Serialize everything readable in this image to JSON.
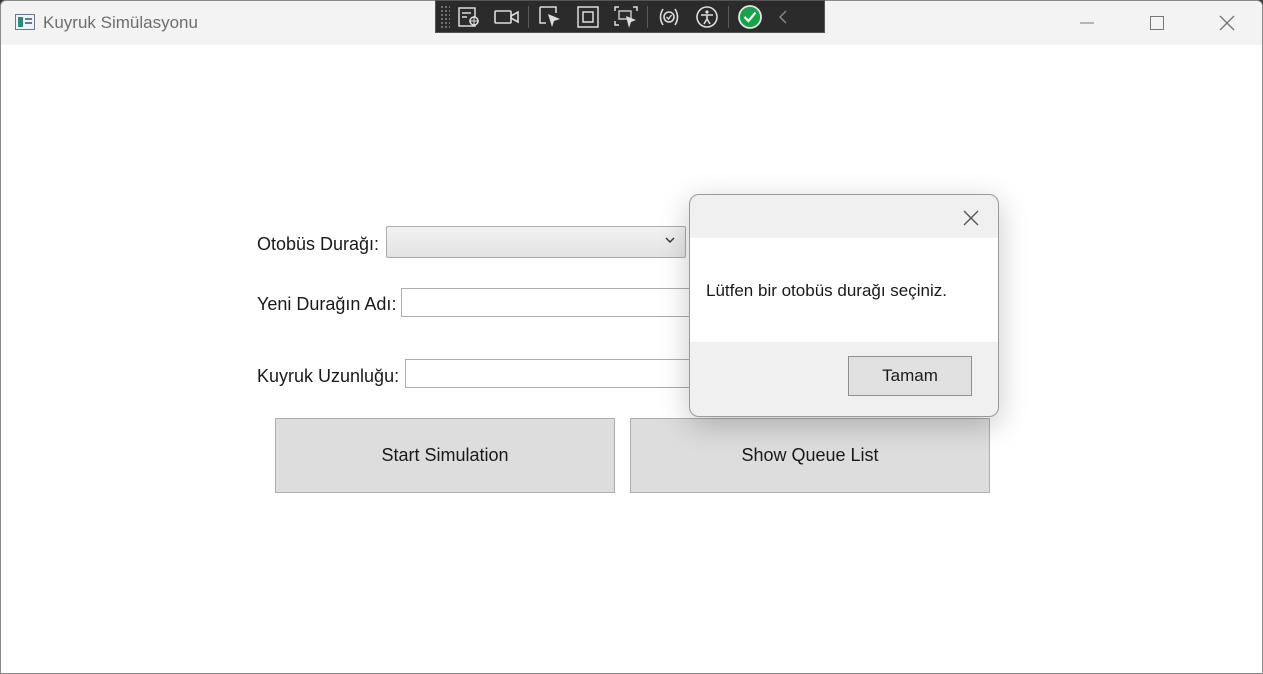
{
  "window": {
    "title": "Kuyruk Simülasyonu"
  },
  "devtools_toolbar": {
    "items": [
      "live-visual-tree-icon",
      "video-camera-icon",
      "select-element-icon",
      "display-layout-adorners-icon",
      "track-focus-icon",
      "binding-failures-icon",
      "accessibility-icon",
      "hot-reload-ok-icon",
      "collapse-chevron-icon"
    ]
  },
  "form": {
    "bus_stop_label": "Otobüs Durağı:",
    "new_stop_label": "Yeni Durağın Adı:",
    "queue_length_label": "Kuyruk Uzunluğu:",
    "bus_stop_value": "",
    "new_stop_value": "",
    "queue_length_value": "",
    "start_button": "Start Simulation",
    "show_queue_button": "Show Queue List"
  },
  "dialog": {
    "message": "Lütfen bir otobüs durağı seçiniz.",
    "ok_button": "Tamam"
  },
  "colors": {
    "titlebar": "#f3f3f3",
    "button_face": "#dddddd",
    "devbar": "#2b2b2b",
    "hot_reload_ok": "#16a34a"
  }
}
